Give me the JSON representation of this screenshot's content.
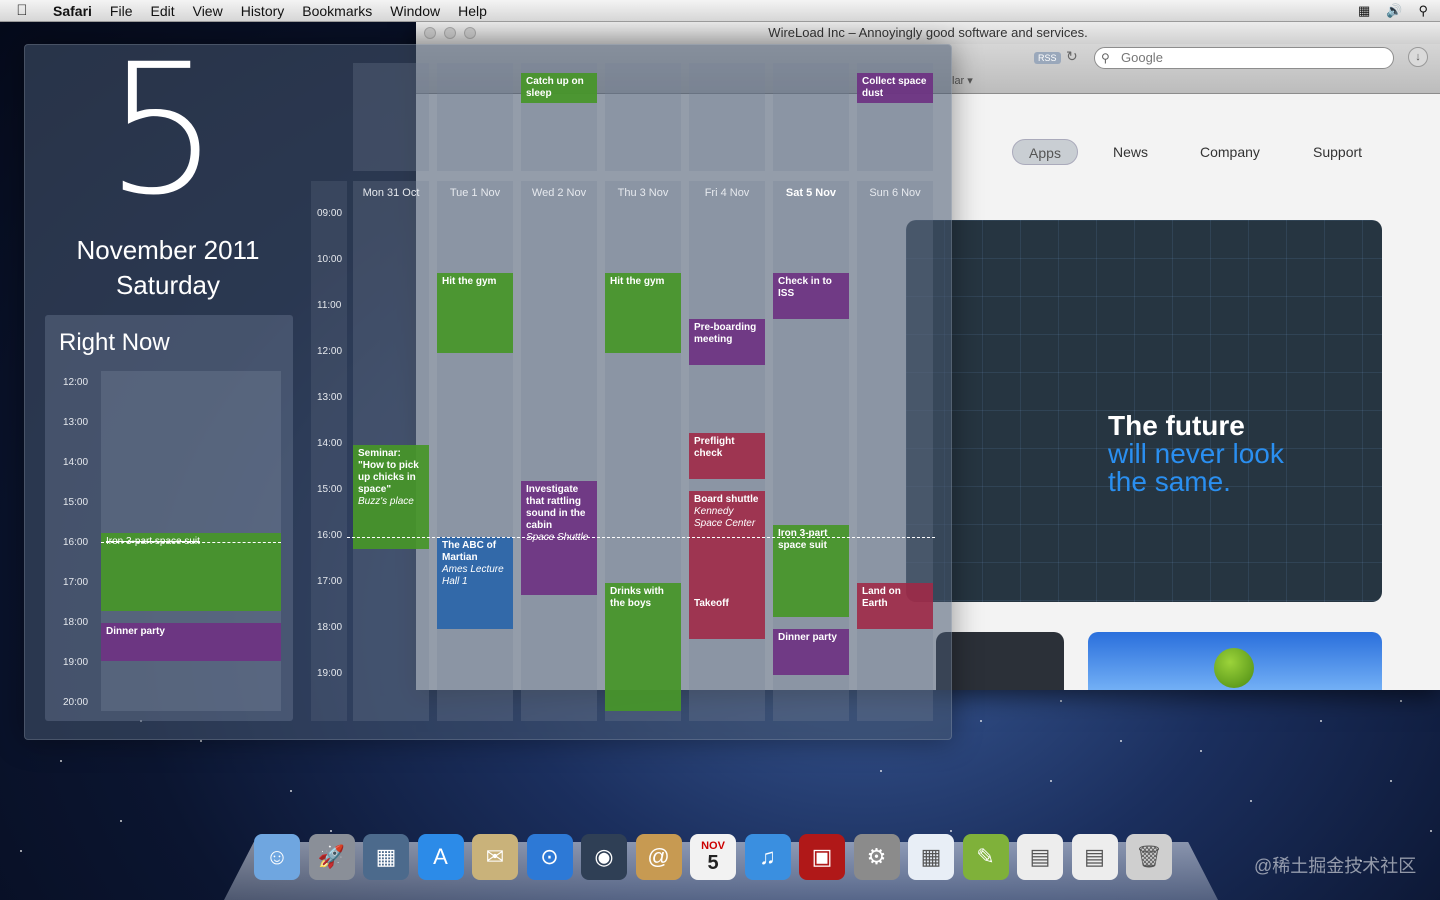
{
  "menubar": {
    "apple": "",
    "app": "Safari",
    "items": [
      "File",
      "Edit",
      "View",
      "History",
      "Bookmarks",
      "Window",
      "Help"
    ]
  },
  "safari": {
    "title": "WireLoad Inc – Annoyingly good software and services.",
    "rss": "RSS",
    "search_placeholder": "Google",
    "toolbar_fragment": "lar ▾",
    "nav": {
      "apps": "Apps",
      "news": "News",
      "company": "Company",
      "support": "Support"
    },
    "hero": {
      "line1": "The future",
      "line2": "will never look",
      "line3": "the same."
    }
  },
  "calendar": {
    "day_number": "5",
    "month_year": "November 2011",
    "weekday": "Saturday",
    "right_now_title": "Right Now",
    "right_now_hours": [
      "12:00",
      "13:00",
      "14:00",
      "15:00",
      "16:00",
      "17:00",
      "18:00",
      "19:00",
      "20:00"
    ],
    "right_now_events": [
      {
        "title": "Iron 3-part space suit",
        "color": "green"
      },
      {
        "title": "Dinner party",
        "color": "purple"
      }
    ],
    "hours": [
      "09:00",
      "10:00",
      "11:00",
      "12:00",
      "13:00",
      "14:00",
      "15:00",
      "16:00",
      "17:00",
      "18:00",
      "19:00"
    ],
    "days": [
      "Mon 31 Oct",
      "Tue 1 Nov",
      "Wed 2 Nov",
      "Thu 3 Nov",
      "Fri 4 Nov",
      "Sat 5 Nov",
      "Sun 6 Nov"
    ],
    "all_day": [
      {
        "day": 2,
        "title": "Catch up on sleep",
        "color": "green"
      },
      {
        "day": 6,
        "title": "Collect space dust",
        "color": "purple"
      }
    ],
    "events": [
      {
        "day": 0,
        "title": "Seminar: \"How to pick up chicks in space\"",
        "sub": "Buzz's place",
        "color": "green"
      },
      {
        "day": 1,
        "title": "Hit the gym",
        "sub": "",
        "color": "green"
      },
      {
        "day": 1,
        "title": "The ABC of Martian",
        "sub": "Ames Lecture Hall 1",
        "color": "blue"
      },
      {
        "day": 2,
        "title": "Investigate that rattling sound in the cabin",
        "sub": "Space Shuttle",
        "color": "purple"
      },
      {
        "day": 3,
        "title": "Hit the gym",
        "sub": "",
        "color": "green"
      },
      {
        "day": 3,
        "title": "Drinks with the boys",
        "sub": "",
        "color": "green"
      },
      {
        "day": 4,
        "title": "Pre-boarding meeting",
        "sub": "",
        "color": "purple"
      },
      {
        "day": 4,
        "title": "Preflight check",
        "sub": "",
        "color": "red"
      },
      {
        "day": 4,
        "title": "Board shuttle",
        "sub": "Kennedy Space Center",
        "color": "red"
      },
      {
        "day": 4,
        "title": "Takeoff",
        "sub": "",
        "color": "red"
      },
      {
        "day": 5,
        "title": "Check in to ISS",
        "sub": "",
        "color": "purple"
      },
      {
        "day": 5,
        "title": "Iron 3-part space suit",
        "sub": "",
        "color": "green"
      },
      {
        "day": 5,
        "title": "Dinner party",
        "sub": "",
        "color": "purple"
      },
      {
        "day": 6,
        "title": "Land on Earth",
        "sub": "",
        "color": "red"
      }
    ],
    "colors": {
      "green": "#46962a",
      "purple": "#6e3282",
      "red": "#a02846",
      "blue": "#2864aa"
    }
  },
  "dock": {
    "items": [
      "finder-icon",
      "launchpad-icon",
      "photo-icon",
      "app-store-icon",
      "mail-icon",
      "safari-icon",
      "facetime-icon",
      "address-book-icon",
      "calendar-icon",
      "itunes-icon",
      "photo-booth-icon",
      "system-preferences-icon",
      "calendar-grid-icon",
      "utility-icon",
      "document-icon",
      "document-icon-2",
      "trash-icon"
    ],
    "calendar_icon_day": "5",
    "calendar_icon_month": "NOV"
  },
  "watermark": "@稀土掘金技术社区"
}
